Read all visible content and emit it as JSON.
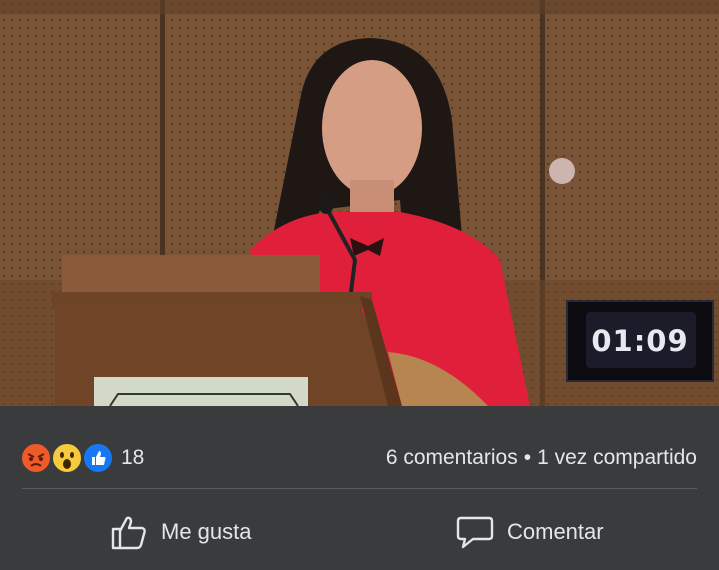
{
  "video": {
    "timer": "01:09"
  },
  "post": {
    "reaction_icons": [
      "angry-icon",
      "wow-icon",
      "like-icon"
    ],
    "reaction_count": "18",
    "comments": "6 comentarios",
    "separator": "•",
    "shares": "1 vez compartido"
  },
  "actions": {
    "like_label": "Me gusta",
    "comment_label": "Comentar"
  },
  "colors": {
    "background": "#3a3b3d",
    "text": "#e4e6eb",
    "like_blue": "#1877f2",
    "angry": "#f05a28",
    "wow": "#f7c93c",
    "jacket_red": "#e0203a"
  }
}
